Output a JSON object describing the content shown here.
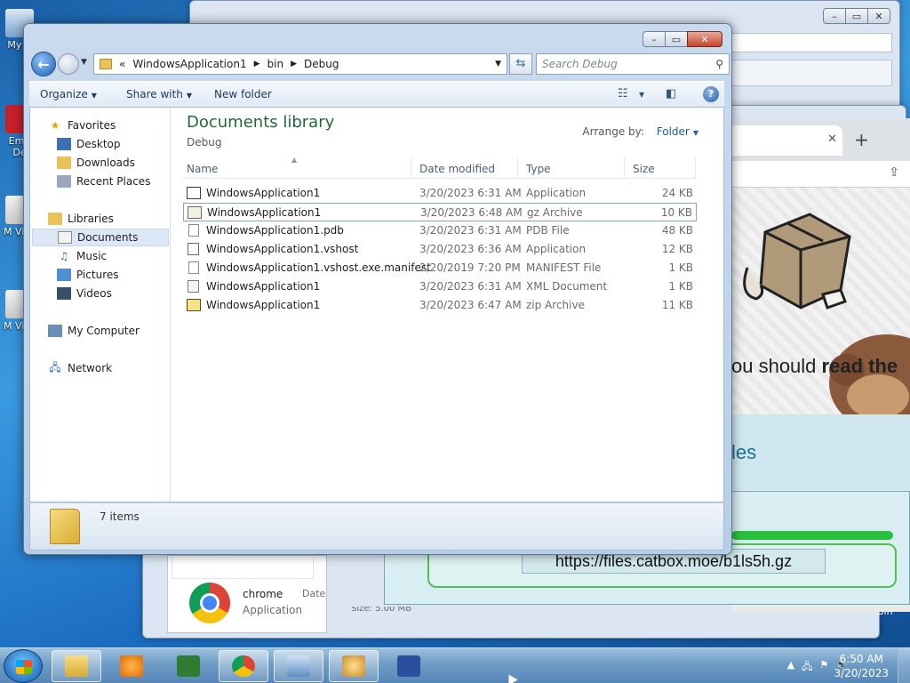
{
  "desktop": {
    "icons": [
      "My C",
      "Emb De",
      "M Visu",
      "M Visu"
    ]
  },
  "explorer": {
    "caption_buttons": {
      "minimize": "–",
      "maximize": "▭",
      "close": "✕"
    },
    "address": {
      "overflow": "«",
      "crumbs": [
        "WindowsApplication1",
        "bin",
        "Debug"
      ]
    },
    "search_placeholder": "Search Debug",
    "toolbar": {
      "organize": "Organize",
      "share_with": "Share with",
      "new_folder": "New folder"
    },
    "nav": {
      "favorites": "Favorites",
      "desktop": "Desktop",
      "downloads": "Downloads",
      "recent_places": "Recent Places",
      "libraries": "Libraries",
      "documents": "Documents",
      "music": "Music",
      "pictures": "Pictures",
      "videos": "Videos",
      "my_computer": "My Computer",
      "network": "Network"
    },
    "library_title": "Documents library",
    "library_subtitle": "Debug",
    "arrange_label": "Arrange by:",
    "arrange_value": "Folder",
    "columns": {
      "name": "Name",
      "date": "Date modified",
      "type": "Type",
      "size": "Size"
    },
    "files": [
      {
        "name": "WindowsApplication1",
        "date": "3/20/2023 6:31 AM",
        "type": "Application",
        "size": "24 KB"
      },
      {
        "name": "WindowsApplication1",
        "date": "3/20/2023 6:48 AM",
        "type": "gz Archive",
        "size": "10 KB"
      },
      {
        "name": "WindowsApplication1.pdb",
        "date": "3/20/2023 6:31 AM",
        "type": "PDB File",
        "size": "48 KB"
      },
      {
        "name": "WindowsApplication1.vshost",
        "date": "3/20/2023 6:36 AM",
        "type": "Application",
        "size": "12 KB"
      },
      {
        "name": "WindowsApplication1.vshost.exe.manifest",
        "date": "2/20/2019 7:20 PM",
        "type": "MANIFEST File",
        "size": "1 KB"
      },
      {
        "name": "WindowsApplication1",
        "date": "3/20/2023 6:31 AM",
        "type": "XML Document",
        "size": "1 KB"
      },
      {
        "name": "WindowsApplication1",
        "date": "3/20/2023 6:47 AM",
        "type": "zip Archive",
        "size": "11 KB"
      }
    ],
    "item_count": "7 items"
  },
  "browser": {
    "tab_close": "✕",
    "new_tab": "+",
    "read_text_prefix": "ou should ",
    "read_text_bold": "read the",
    "files_heading": "les",
    "url": "https://files.catbox.moe/b1ls5h.gz"
  },
  "info_window": {
    "name": "chrome",
    "type": "Application",
    "date_label": "Date",
    "size_label": "Size: 5.00 MB"
  },
  "bg_label": "Bin",
  "taskbar": {
    "time": "6:50 AM",
    "date": "3/20/2023"
  }
}
